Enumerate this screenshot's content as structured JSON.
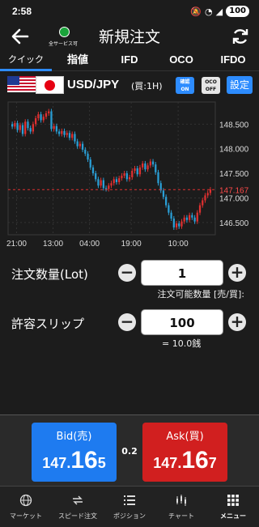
{
  "status": {
    "time": "2:58",
    "battery": "100"
  },
  "header": {
    "title": "新規注文",
    "server_label": "全サービス可"
  },
  "tabs": [
    {
      "label": "クイック"
    },
    {
      "label": "指値"
    },
    {
      "label": "IFD"
    },
    {
      "label": "OCO"
    },
    {
      "label": "IFDO"
    }
  ],
  "pair": {
    "name": "USD/JPY",
    "subtitle": "(買:1H)",
    "confirm_line1": "確認",
    "confirm_line2": "ON",
    "oco_line1": "OCO",
    "oco_line2": "OFF",
    "settings_label": "設定"
  },
  "chart_data": {
    "type": "candlestick",
    "y_ticks": [
      "148.500",
      "148.000",
      "147.500",
      "147.000",
      "146.500"
    ],
    "x_ticks": [
      "21:00",
      "13:00",
      "04:00",
      "19:00",
      "10:00"
    ],
    "current_price_label": "147.167",
    "ylim": [
      146.25,
      148.95
    ],
    "close_series": [
      148.45,
      148.52,
      148.38,
      148.48,
      148.3,
      148.55,
      148.42,
      148.35,
      148.5,
      148.62,
      148.7,
      148.58,
      148.65,
      148.72,
      148.76,
      148.4,
      148.46,
      148.35,
      148.3,
      148.36,
      148.28,
      148.32,
      148.22,
      148.3,
      148.15,
      148.05,
      148.1,
      147.98,
      147.9,
      147.78,
      147.62,
      147.5,
      147.38,
      147.25,
      147.36,
      147.2,
      147.18,
      147.25,
      147.3,
      147.38,
      147.32,
      147.4,
      147.45,
      147.5,
      147.38,
      147.42,
      147.55,
      147.6,
      147.48,
      147.62,
      147.7,
      147.58,
      147.66,
      147.74,
      147.68,
      147.52,
      147.3,
      147.15,
      147.02,
      146.85,
      146.7,
      146.58,
      146.4,
      146.48,
      146.42,
      146.52,
      146.6,
      146.55,
      146.65,
      146.6,
      146.52,
      146.7,
      146.85,
      146.95,
      147.05,
      147.1,
      147.17
    ]
  },
  "order": {
    "qty_label": "注文数量(Lot)",
    "qty_value": "1",
    "qty_note": "注文可能数量 [売/買]:",
    "slip_label": "許容スリップ",
    "slip_value": "100",
    "slip_note": "= 10.0銭",
    "minus": "−",
    "plus": "+"
  },
  "quote": {
    "bid_label": "Bid(売)",
    "bid_main": "147.",
    "bid_big": "16",
    "bid_last": "5",
    "ask_label": "Ask(買)",
    "ask_main": "147.",
    "ask_big": "16",
    "ask_last": "7",
    "spread": "0.2"
  },
  "nav": [
    {
      "label": "マーケット",
      "icon": "globe-icon"
    },
    {
      "label": "スピード注文",
      "icon": "speed-icon"
    },
    {
      "label": "ポジション",
      "icon": "list-icon"
    },
    {
      "label": "チャート",
      "icon": "chart-icon"
    },
    {
      "label": "メニュー",
      "icon": "grid-icon"
    }
  ],
  "colors": {
    "accent": "#2d8cff",
    "bid": "#1e7bf0",
    "ask": "#d11f1f",
    "up_candle": "#e03030",
    "down_candle": "#2a9fd6"
  }
}
